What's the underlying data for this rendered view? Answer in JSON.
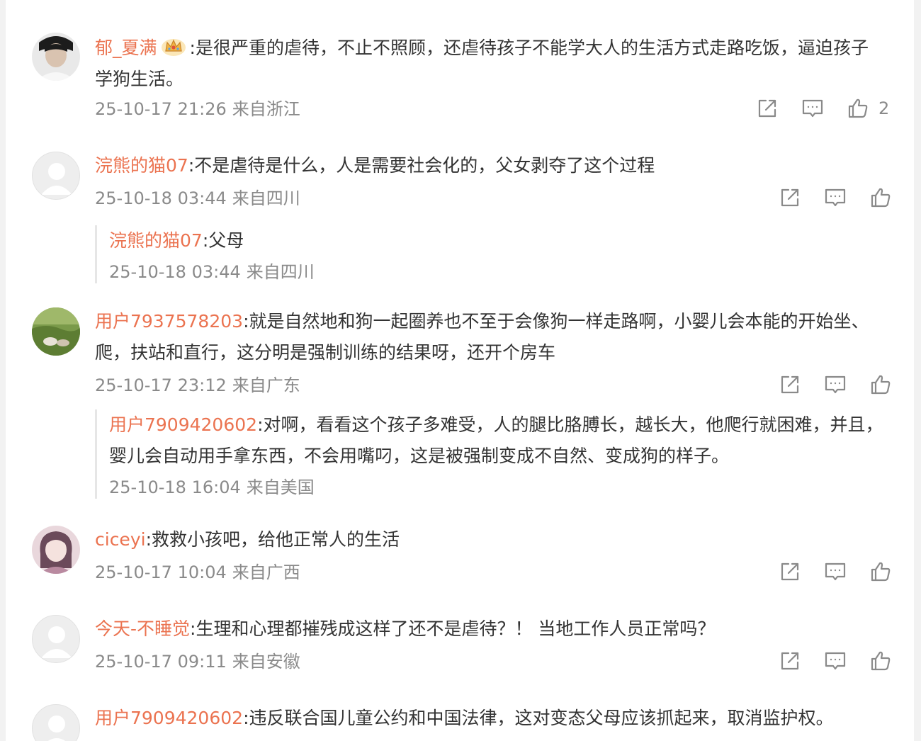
{
  "comments": [
    {
      "username": "郁_夏满",
      "text": ":是很严重的虐待，不止不照顾，还虐待孩子不能学大人的生活方式走路吃饭，逼迫孩子学狗生活。",
      "time": "25-10-17 21:26",
      "location": "来自浙江",
      "likes": "2"
    },
    {
      "username": "浣熊的猫07",
      "text": ":不是虐待是什么，人是需要社会化的，父女剥夺了这个过程",
      "time": "25-10-18 03:44",
      "location": "来自四川",
      "reply": {
        "username": "浣熊的猫07",
        "text": ":父母",
        "time": "25-10-18 03:44",
        "location": "来自四川"
      }
    },
    {
      "username": "用户7937578203",
      "text": ":就是自然地和狗一起圈养也不至于会像狗一样走路啊，小婴儿会本能的开始坐、爬，扶站和直行，这分明是强制训练的结果呀，还开个房车",
      "time": "25-10-17 23:12",
      "location": "来自广东",
      "reply": {
        "username": "用户7909420602",
        "text": ":对啊，看看这个孩子多难受，人的腿比胳膊长，越长大，他爬行就困难，并且，婴儿会自动用手拿东西，不会用嘴叼，这是被强制变成不自然、变成狗的样子。",
        "time": "25-10-18 16:04",
        "location": "来自美国"
      }
    },
    {
      "username": "ciceyi",
      "text": ":救救小孩吧，给他正常人的生活",
      "time": "25-10-17 10:04",
      "location": "来自广西"
    },
    {
      "username": "今天-不睡觉",
      "text": ":生理和心理都摧残成这样了还不是虐待？！ 当地工作人员正常吗？",
      "time": "25-10-17 09:11",
      "location": "来自安徽"
    },
    {
      "username": "用户7909420602",
      "text": ":违反联合国儿童公约和中国法律，这对变态父母应该抓起来，取消监护权。"
    }
  ],
  "colors": {
    "username": "#eb7350",
    "meta": "#8a8a8a",
    "icon": "#8a8a8a",
    "divider": "#e6e6e6"
  },
  "icons": {
    "share": "share-icon",
    "comment": "comment-icon",
    "like": "like-icon",
    "badge": "crown-badge-icon"
  }
}
